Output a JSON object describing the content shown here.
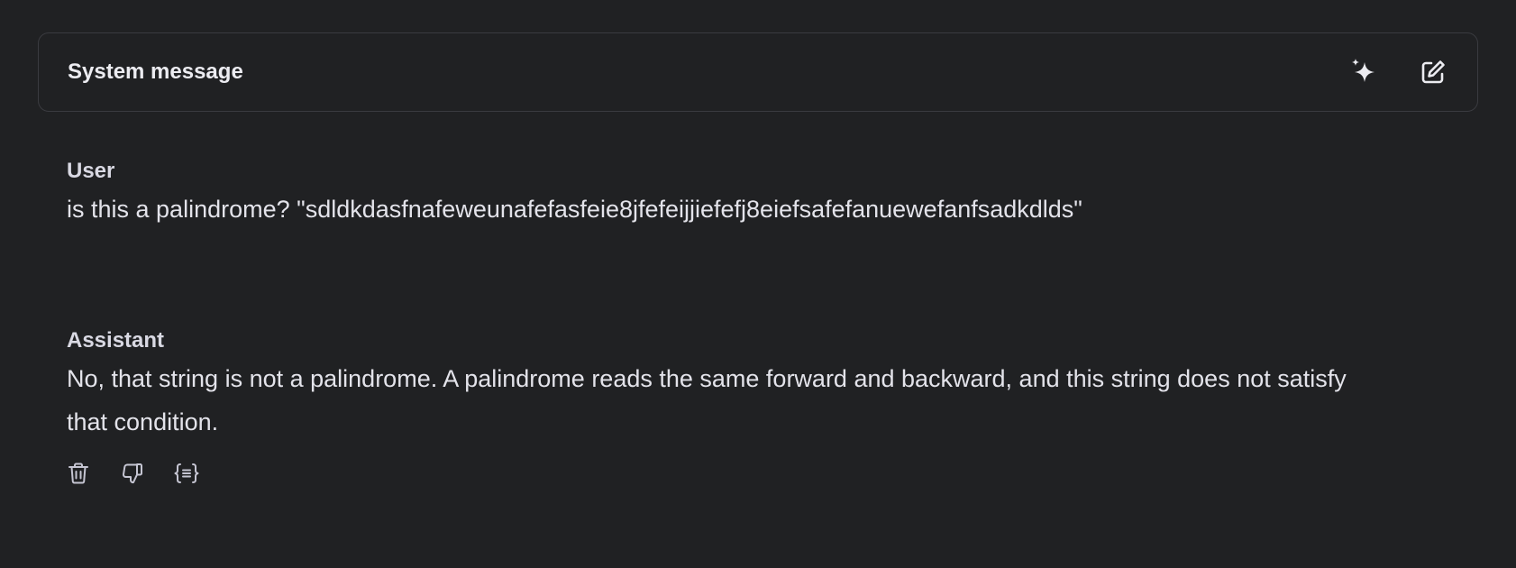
{
  "system": {
    "title": "System message",
    "icons": [
      "sparkle-icon",
      "edit-icon"
    ]
  },
  "messages": [
    {
      "role": "User",
      "text": "is this a palindrome? \"sdldkdasfnafeweunafefasfeie8jfefeijjiefefj8eiefsafefanuewefanfsadkdlds\""
    },
    {
      "role": "Assistant",
      "text": "No, that string is not a palindrome. A palindrome reads the same forward and backward, and this string does not satisfy that condition."
    }
  ],
  "message_actions": {
    "icons": [
      "trash-icon",
      "thumbs-down-icon",
      "code-braces-icon"
    ]
  },
  "colors": {
    "background": "#202123",
    "border": "#3a3b40",
    "text": "#ececf1",
    "icon": "#c5c5d2"
  }
}
